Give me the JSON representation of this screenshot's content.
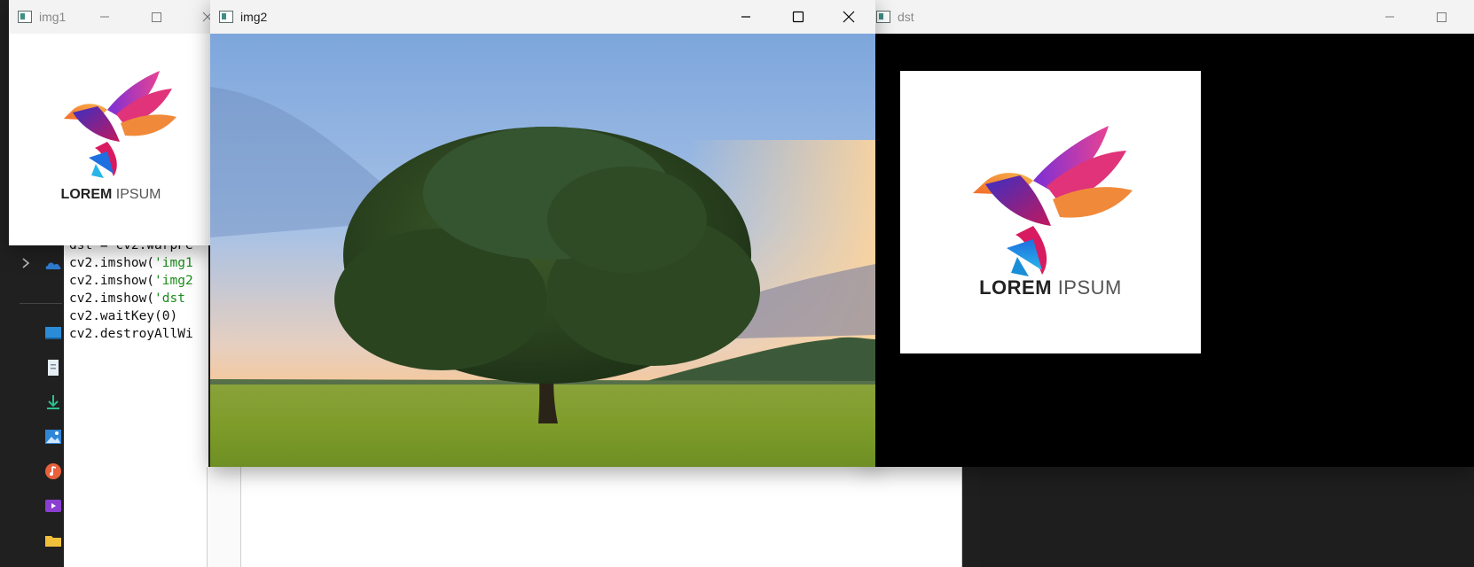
{
  "windows": {
    "img1": {
      "title": "img1"
    },
    "img2": {
      "title": "img2"
    },
    "dst": {
      "title": "dst"
    }
  },
  "logo": {
    "word1": "LOREM",
    "word2": "IPSUM"
  },
  "code": {
    "lines": [
      "dst = cv2.warpPe",
      "cv2.imshow('img1",
      "cv2.imshow('img2",
      "cv2.imshow('dst",
      "cv2.waitKey(0)",
      "cv2.destroyAllWi"
    ]
  },
  "colors": {
    "accent": "#3f8f86"
  }
}
